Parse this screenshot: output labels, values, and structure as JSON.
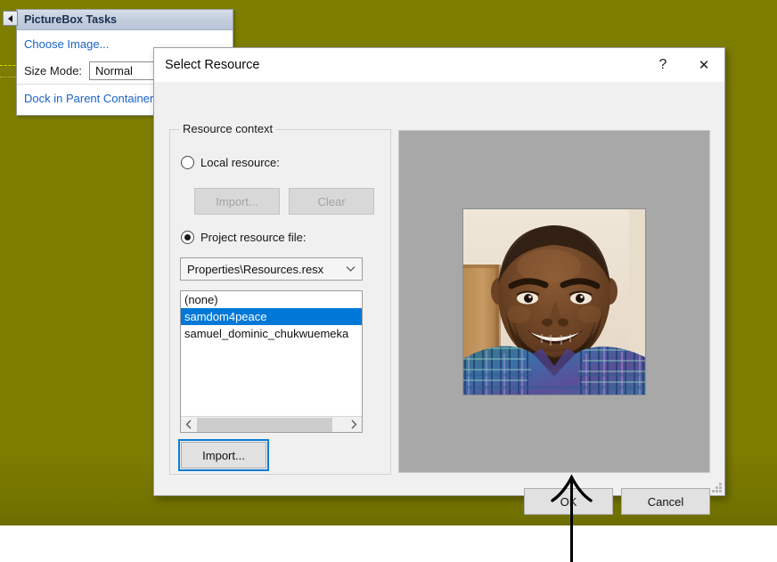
{
  "canvas": {
    "background_color": "#7d7d00",
    "strip_color": "#ffffff"
  },
  "tasks_panel": {
    "header_title": "PictureBox Tasks",
    "choose_image_label": "Choose Image...",
    "size_mode_label": "Size Mode:",
    "size_mode_value": "Normal",
    "dock_label": "Dock in Parent Container",
    "smart_tag_icon": "triangle-left-icon"
  },
  "dialog": {
    "title": "Select Resource",
    "help_glyph": "?",
    "close_glyph": "✕",
    "group": {
      "title": "Resource context",
      "local_resource_label": "Local resource:",
      "local_selected": false,
      "import_disabled_label": "Import...",
      "clear_disabled_label": "Clear",
      "project_resource_label": "Project resource file:",
      "project_selected": true,
      "resx_value": "Properties\\Resources.resx",
      "resx_chevron_icon": "chevron-down-icon",
      "list_items": [
        {
          "label": "(none)",
          "selected": false
        },
        {
          "label": "samdom4peace",
          "selected": true
        },
        {
          "label": "samuel_dominic_chukwuemeka",
          "selected": false
        }
      ],
      "scroll_left_icon": "chevron-left-icon",
      "scroll_right_icon": "chevron-right-icon",
      "import_label": "Import..."
    },
    "preview": {
      "background_color": "#a8a8a8",
      "image_description": "portrait-photo"
    },
    "ok_label": "OK",
    "cancel_label": "Cancel"
  },
  "annotation": {
    "arrow_icon": "arrow-up-icon",
    "arrow_color": "#000000"
  },
  "colors": {
    "selection_blue": "#0078d7",
    "link_blue": "#1862c6",
    "dialog_face": "#f0f0f0"
  }
}
